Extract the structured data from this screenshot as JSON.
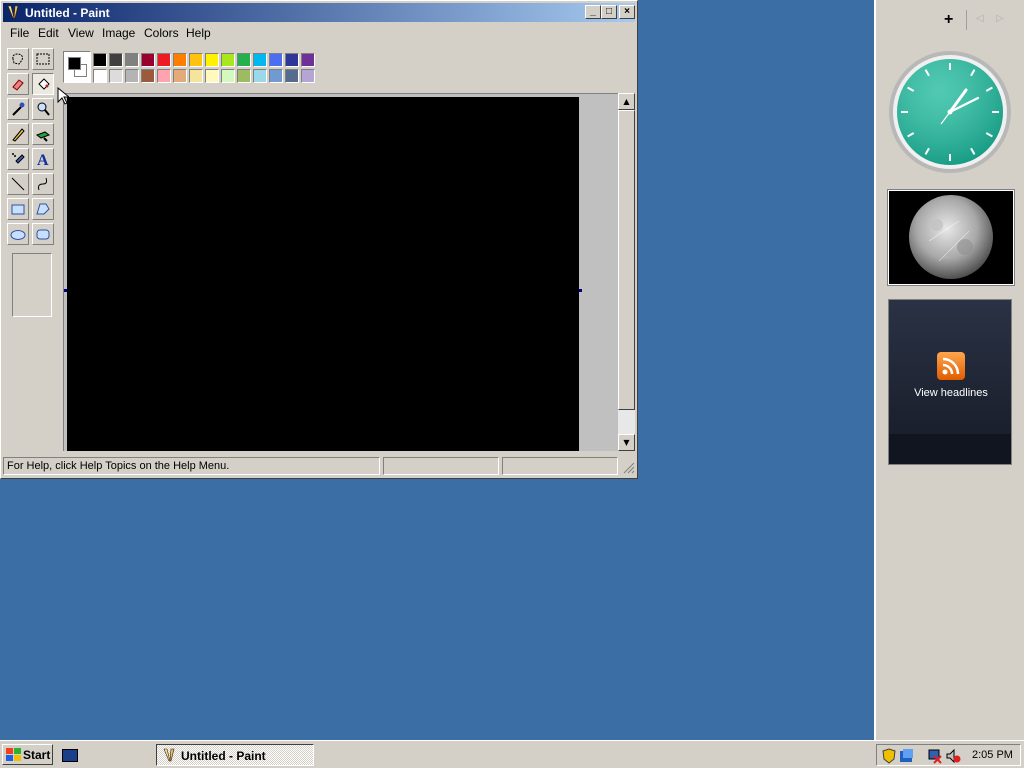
{
  "window": {
    "title": "Untitled - Paint",
    "controls": {
      "minimize": "_",
      "maximize": "□",
      "close": "×"
    }
  },
  "menu": [
    "File",
    "Edit",
    "View",
    "Image",
    "Colors",
    "Help"
  ],
  "tools": [
    {
      "name": "free-form-select-icon"
    },
    {
      "name": "rect-select-icon"
    },
    {
      "name": "eraser-icon"
    },
    {
      "name": "fill-bucket-icon"
    },
    {
      "name": "color-picker-icon"
    },
    {
      "name": "magnifier-icon"
    },
    {
      "name": "pencil-icon"
    },
    {
      "name": "brush-icon"
    },
    {
      "name": "airbrush-icon"
    },
    {
      "name": "text-icon"
    },
    {
      "name": "line-icon"
    },
    {
      "name": "curve-icon"
    },
    {
      "name": "rectangle-icon"
    },
    {
      "name": "polygon-icon"
    },
    {
      "name": "ellipse-icon"
    },
    {
      "name": "rounded-rect-icon"
    }
  ],
  "active_tool": "fill-bucket-icon",
  "text_tool_glyph": "A",
  "palette": {
    "foreground": "#000000",
    "background": "#ffffff",
    "row1": [
      "#000000",
      "#404040",
      "#808080",
      "#990030",
      "#ed1c24",
      "#ff7e00",
      "#ffc20e",
      "#fff200",
      "#a8e61d",
      "#22b14c",
      "#00b7ef",
      "#4d6df3",
      "#2f3699",
      "#6f3198"
    ],
    "row2": [
      "#ffffff",
      "#dcdcdc",
      "#b4b4b4",
      "#9c5a3c",
      "#ffa3b1",
      "#e5aa7a",
      "#f5e49c",
      "#fff9bd",
      "#d3f9bc",
      "#9dbb61",
      "#99d9ea",
      "#709ad1",
      "#546d8e",
      "#b5a5d5"
    ]
  },
  "canvas": {
    "color": "#000000"
  },
  "status": {
    "help": "For Help, click Help Topics on the Help Menu.",
    "coords": "",
    "size": ""
  },
  "sidebar": {
    "add": "+",
    "prev": "◁",
    "next": "▷",
    "rss_label": "View headlines"
  },
  "taskbar": {
    "start": "Start",
    "task": "Untitled - Paint",
    "time": "2:05 PM"
  }
}
